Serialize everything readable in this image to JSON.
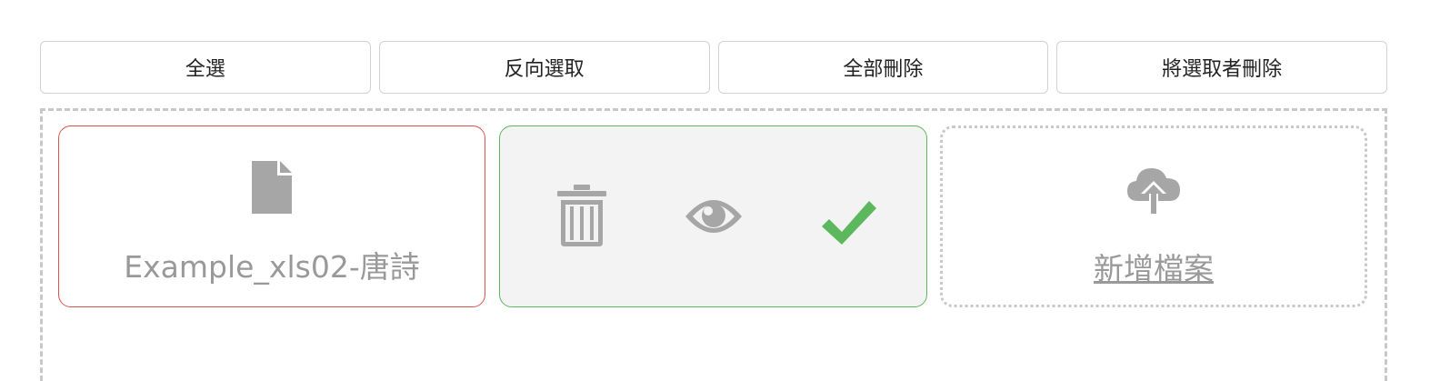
{
  "toolbar": {
    "select_all": "全選",
    "invert_selection": "反向選取",
    "delete_all": "全部刪除",
    "delete_selected": "將選取者刪除"
  },
  "files": [
    {
      "name": "Example_xls02-唐詩",
      "icon": "file-icon"
    }
  ],
  "actions": {
    "delete_icon": "trash-icon",
    "preview_icon": "eye-icon",
    "confirm_icon": "check-icon"
  },
  "add_file": {
    "label": "新增檔案",
    "icon": "cloud-upload-icon"
  },
  "colors": {
    "error_border": "#d9534f",
    "success_border": "#5cb85c",
    "check_green": "#5cb85c",
    "icon_gray": "#a6a6a6",
    "text_gray": "#999999"
  }
}
